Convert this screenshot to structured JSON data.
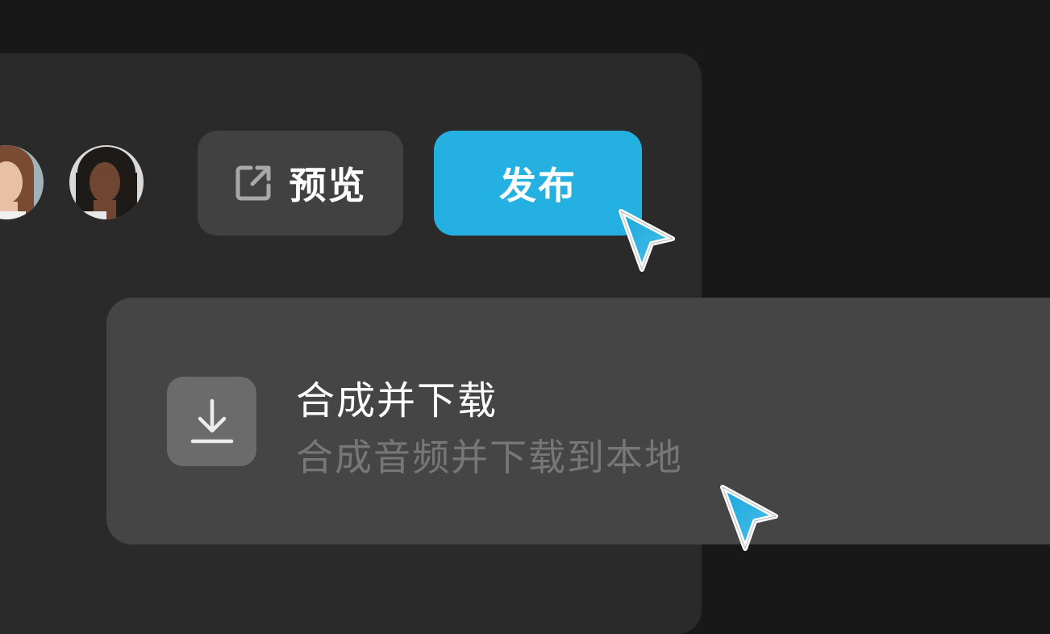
{
  "header": {
    "preview_label": "预览",
    "publish_label": "发布",
    "preview_icon": "external-link-icon"
  },
  "collaborators": [
    {
      "name": "",
      "avatar_hint": "woman-light-hair"
    },
    {
      "name": "",
      "avatar_hint": "woman-dark-hair"
    }
  ],
  "menu": {
    "item": {
      "title": "合成并下载",
      "description": "合成音频并下载到本地",
      "icon": "download-icon"
    }
  },
  "colors": {
    "accent": "#24b1e1",
    "panel_bg": "#2a2a2a",
    "menu_bg": "#454545",
    "page_bg": "#181818"
  }
}
